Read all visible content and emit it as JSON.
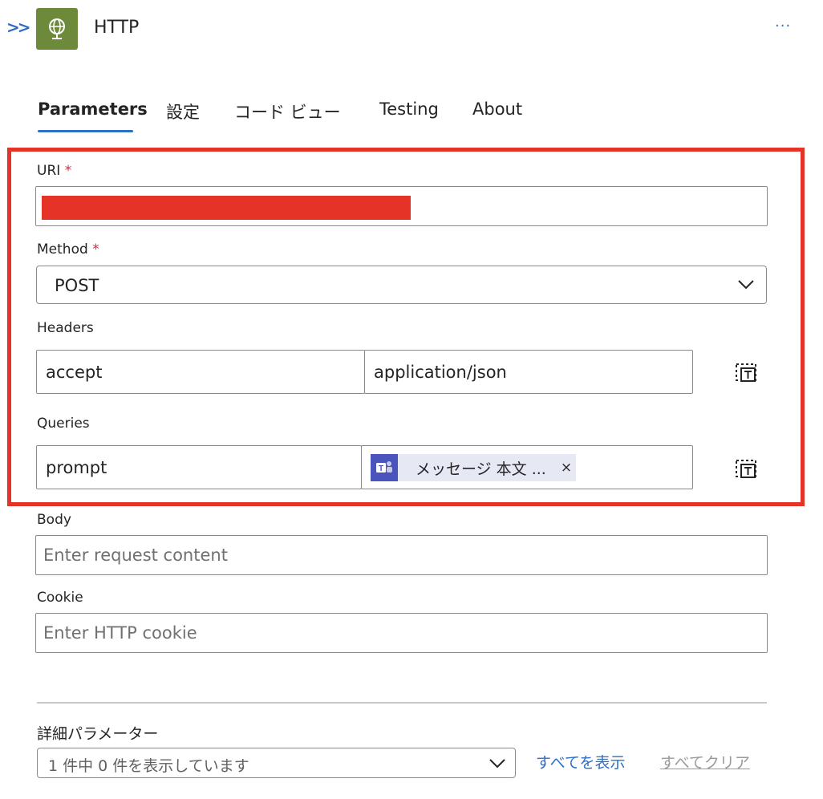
{
  "header": {
    "title": "HTTP",
    "expand_icon": "double-chevron-right-icon",
    "app_icon": "globe-icon",
    "more_icon": "ellipsis-icon"
  },
  "tabs": [
    {
      "label": "Parameters",
      "active": true
    },
    {
      "label": "設定"
    },
    {
      "label": "コード ビュー"
    },
    {
      "label": "Testing"
    },
    {
      "label": "About"
    }
  ],
  "uri": {
    "label": "URI",
    "required": "*"
  },
  "method": {
    "label": "Method",
    "required": "*",
    "value": "POST"
  },
  "headers": {
    "label": "Headers",
    "key": "accept",
    "value": "application/json",
    "delete_icon": "delete-icon"
  },
  "queries": {
    "label": "Queries",
    "key": "prompt",
    "token_label": "メッセージ 本文 ...",
    "token_icon": "teams-icon",
    "token_remove": "×",
    "delete_icon": "delete-icon"
  },
  "body": {
    "label": "Body",
    "placeholder": "Enter request content"
  },
  "cookie": {
    "label": "Cookie",
    "placeholder": "Enter HTTP cookie"
  },
  "advanced": {
    "label": "詳細パラメーター",
    "select_value": "1 件中 0 件を表示しています",
    "show_all": "すべてを表示",
    "clear_all": "すべてクリア"
  },
  "colors": {
    "accent": "#2f6fc4",
    "highlight": "#e63328",
    "app_icon_bg": "#6c8a3a",
    "teams": "#4b53bc"
  }
}
